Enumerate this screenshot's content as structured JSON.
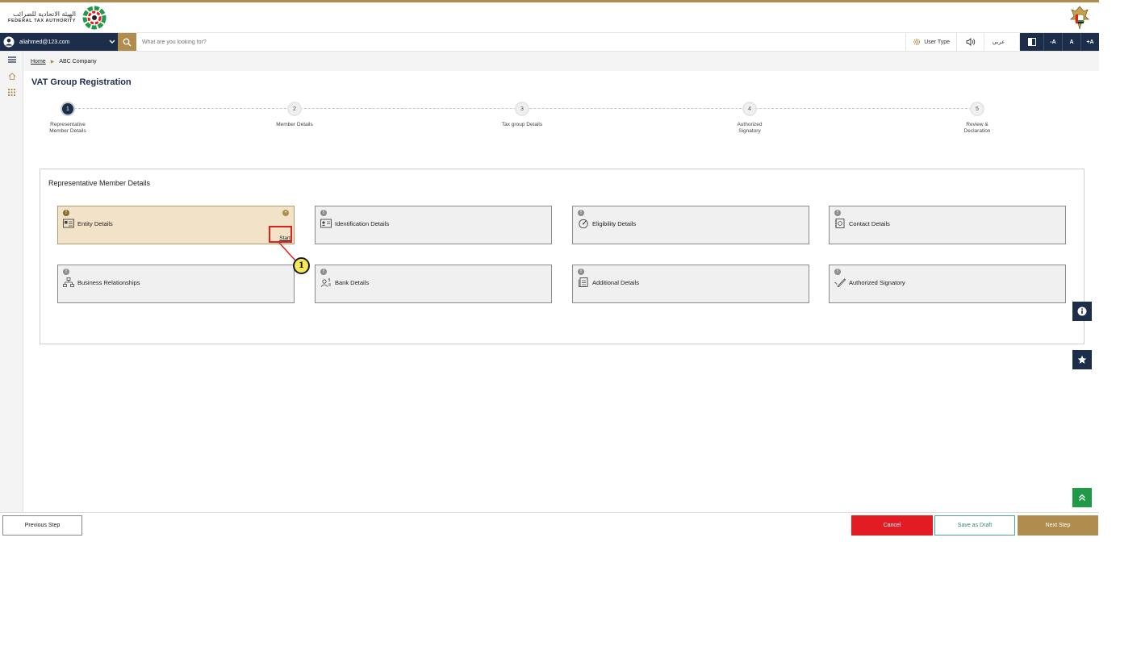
{
  "header": {
    "logo_arabic": "الهيئة الاتحادية للضرائب",
    "logo_english": "FEDERAL TAX AUTHORITY"
  },
  "searchbar": {
    "user_email": "aliahmed@123.com",
    "search_placeholder": "What are you looking for?",
    "user_type_label": "User Type",
    "arabic_label": "عربي",
    "font_decrease": "-A",
    "font_normal": "A",
    "font_increase": "+A"
  },
  "breadcrumb": {
    "home": "Home",
    "current": "ABC Company"
  },
  "page": {
    "title": "VAT Group Registration"
  },
  "stepper": {
    "steps": [
      {
        "number": "1",
        "label_line1": "Representative",
        "label_line2": "Member Details",
        "active": true
      },
      {
        "number": "2",
        "label_line1": "Member Details",
        "label_line2": ""
      },
      {
        "number": "3",
        "label_line1": "Tax group Details",
        "label_line2": ""
      },
      {
        "number": "4",
        "label_line1": "Authorized",
        "label_line2": "Signatory"
      },
      {
        "number": "5",
        "label_line1": "Review &",
        "label_line2": "Declaration"
      }
    ]
  },
  "panel": {
    "title": "Representative Member Details",
    "cards": [
      {
        "label": "Entity Details",
        "icon": "id-card-icon",
        "start_label": "Start",
        "active": true
      },
      {
        "label": "Identification Details",
        "icon": "id-badge-icon"
      },
      {
        "label": "Eligibility Details",
        "icon": "gauge-icon"
      },
      {
        "label": "Contact Details",
        "icon": "contact-book-icon"
      },
      {
        "label": "Business Relationships",
        "icon": "org-chart-icon"
      },
      {
        "label": "Bank Details",
        "icon": "bank-user-icon"
      },
      {
        "label": "Additional Details",
        "icon": "document-icon"
      },
      {
        "label": "Authorized Signatory",
        "icon": "pen-signature-icon"
      }
    ]
  },
  "annotation": {
    "callout_number": "1"
  },
  "footer": {
    "previous_label": "Previous Step",
    "cancel_label": "Cancel",
    "draft_label": "Save as Draft",
    "next_label": "Next Step"
  },
  "colors": {
    "navy": "#1c2e4a",
    "gold": "#b08d4f",
    "cancel_red": "#e31b23",
    "active_card": "#f2e2c8",
    "scroll_top_green": "#1f9a47"
  }
}
